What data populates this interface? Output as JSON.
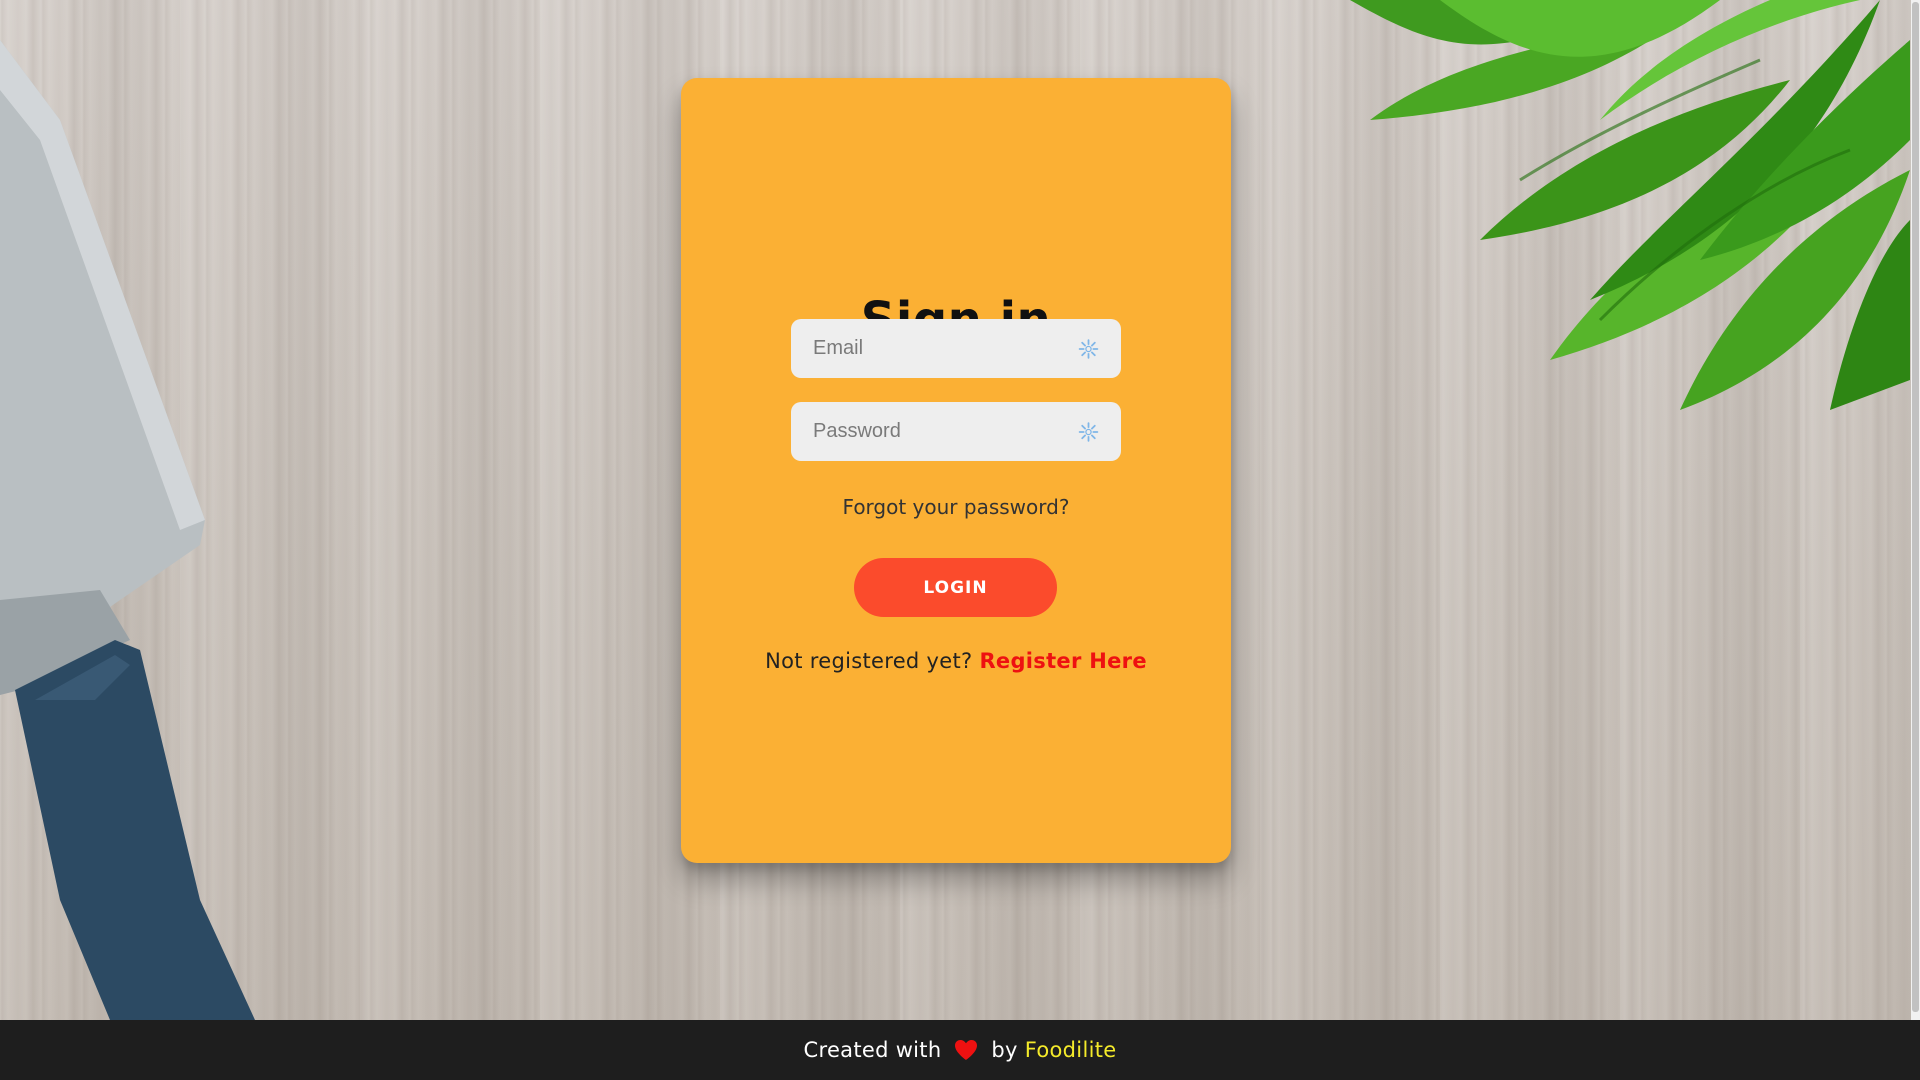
{
  "card": {
    "title": "Sign in",
    "email": {
      "placeholder": "Email",
      "value": "",
      "icon": "spinner-icon"
    },
    "password": {
      "placeholder": "Password",
      "value": "",
      "icon": "spinner-icon"
    },
    "forgot_link": "Forgot your password?",
    "login_label": "LOGIN",
    "register_prompt": "Not registered yet? ",
    "register_link": "Register Here"
  },
  "footer": {
    "prefix": "Created with ",
    "icon": "heart-icon",
    "middle": " by ",
    "brand": "Foodilite"
  },
  "colors": {
    "card": "#fbb034",
    "login_button": "#fb4b2c",
    "register_link": "#ee1111",
    "footer_bg": "#1e1e1e",
    "brand": "#f4ea2a"
  }
}
